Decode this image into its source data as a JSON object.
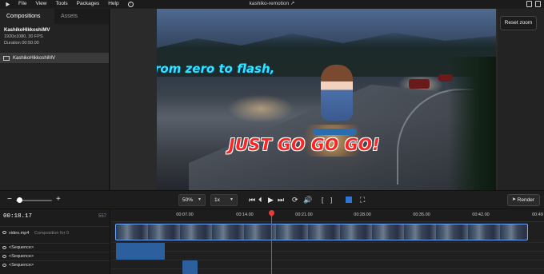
{
  "menu": {
    "items": [
      "File",
      "View",
      "Tools",
      "Packages",
      "Help"
    ],
    "title": "kashiko-remotion",
    "title_icon": "↗"
  },
  "left_panel": {
    "tabs": [
      "Compositions",
      "Assets"
    ],
    "composition": {
      "name": "KashikoHikkoshiMV",
      "resolution": "1920x1080, 30 FPS",
      "duration": "Duration 00:50.00"
    },
    "list_item": "KashikoHikkoshiMV"
  },
  "preview": {
    "caption_top": "rom zero to flash,",
    "caption_bottom": "JUST GO GO GO!"
  },
  "right_panel": {
    "reset_zoom": "Reset zoom"
  },
  "controls": {
    "zoom_minus": "−",
    "zoom_plus": "+",
    "zoom_level": 0.05,
    "scale": "50%",
    "speed": "1x",
    "render": "Render"
  },
  "timeline": {
    "timecode": "00:18.17",
    "frame": "557",
    "ticks": [
      "00:07.00",
      "00:14.00",
      "00:21.00",
      "00:28.00",
      "00:35.00",
      "00:42.00",
      "00:49"
    ],
    "tracks": [
      {
        "label": "video.mp4",
        "sub": "Composition for 0"
      },
      {
        "label": "<Sequence>",
        "sub": ""
      },
      {
        "label": "<Sequence>",
        "sub": ""
      },
      {
        "label": "<Sequence>",
        "sub": ""
      }
    ]
  },
  "colors": {
    "accent": "#4a8ce0",
    "playhead": "#e43b3b",
    "caption_top": "#2ee6ff",
    "caption_bottom": "#ff2424"
  }
}
